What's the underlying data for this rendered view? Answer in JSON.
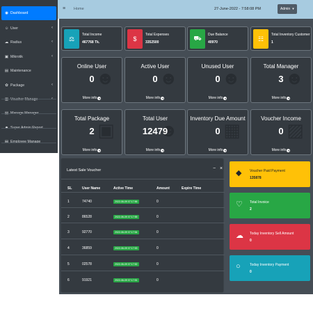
{
  "sidebar": {
    "items": [
      {
        "label": "Dashboard",
        "icon": "dashboard-icon",
        "glyph": "◉",
        "has_submenu": false,
        "active": true
      },
      {
        "label": "User",
        "icon": "user-icon",
        "glyph": "☺",
        "has_submenu": true
      },
      {
        "label": "Radius",
        "icon": "radius-icon",
        "glyph": "☁",
        "has_submenu": true
      },
      {
        "label": "Mikrotik",
        "icon": "mikrotik-icon",
        "glyph": "▣",
        "has_submenu": true
      },
      {
        "label": "Maintenance",
        "icon": "maintenance-icon",
        "glyph": "▤",
        "has_submenu": false
      },
      {
        "label": "Package",
        "icon": "package-icon",
        "glyph": "✿",
        "has_submenu": true
      },
      {
        "label": "Voucher Manage",
        "icon": "voucher-icon",
        "glyph": "▥",
        "has_submenu": true
      },
      {
        "label": "Manage Manager",
        "icon": "manager-icon",
        "glyph": "▤",
        "has_submenu": false
      },
      {
        "label": "Super Admin Report",
        "icon": "report-icon",
        "glyph": "☻",
        "has_submenu": false
      },
      {
        "label": "Employee Manage",
        "icon": "employee-icon",
        "glyph": "▤",
        "has_submenu": false
      }
    ],
    "chevron": "‹"
  },
  "topbar": {
    "menu_glyph": "≡",
    "breadcrumb": "Home",
    "datetime": "27-June-2022 - 7:58:08 PM",
    "admin_label": "Admin",
    "admin_caret": "▾"
  },
  "stats": [
    {
      "title": "Total Income",
      "value": "467768 Tk.",
      "color": "#17a2b8",
      "icon": "scale-icon",
      "glyph": "⚖"
    },
    {
      "title": "Total Expenses",
      "value": "3352500",
      "color": "#dc3545",
      "icon": "money-icon",
      "glyph": "$"
    },
    {
      "title": "Due Balance",
      "value": "40970",
      "color": "#28a745",
      "icon": "cart-icon",
      "glyph": "⛟"
    },
    {
      "title": "Total Inventory Customer",
      "value": "1",
      "color": "#ffc107",
      "icon": "users-icon",
      "glyph": "☷"
    }
  ],
  "summary_row1": [
    {
      "title": "Online User",
      "value": "0",
      "more": "More info",
      "icon": "user-add-icon",
      "glyph": "☻"
    },
    {
      "title": "Active User",
      "value": "0",
      "more": "More info",
      "icon": "user-check-icon",
      "glyph": "☻"
    },
    {
      "title": "Unused User",
      "value": "0",
      "more": "More info",
      "icon": "user-slash-icon",
      "glyph": "☻"
    },
    {
      "title": "Total Manager",
      "value": "3",
      "more": "More info",
      "icon": "manager-tie-icon",
      "glyph": "☻"
    }
  ],
  "summary_row2": [
    {
      "title": "Total Package",
      "value": "2",
      "more": "More info",
      "icon": "box-icon",
      "glyph": "▣"
    },
    {
      "title": "Total User",
      "value": "12479",
      "more": "More info",
      "icon": "user-group-icon",
      "glyph": "☻"
    },
    {
      "title": "Inventory Due Amount",
      "value": "0",
      "more": "More info",
      "icon": "safe-icon",
      "glyph": "▦"
    },
    {
      "title": "Voucher Income",
      "value": "0",
      "more": "More info",
      "icon": "voucher-box-icon",
      "glyph": "▨"
    }
  ],
  "more_arrow": "➜",
  "voucher_table": {
    "title": "Latest Sale Voucher",
    "minimize": "−",
    "close": "×",
    "headers": [
      "SL",
      "User Name",
      "Active Time",
      "Amount",
      "Expire Time"
    ],
    "rows": [
      {
        "sl": "1",
        "user": "74740",
        "time": "2022-06-09 07:17:56",
        "amount": "0",
        "expire": ""
      },
      {
        "sl": "2",
        "user": "86528",
        "time": "2022-06-09 07:17:55",
        "amount": "0",
        "expire": ""
      },
      {
        "sl": "3",
        "user": "92770",
        "time": "2022-06-09 07:17:54",
        "amount": "0",
        "expire": ""
      },
      {
        "sl": "4",
        "user": "36859",
        "time": "2022-06-09 07:17:53",
        "amount": "0",
        "expire": ""
      },
      {
        "sl": "5",
        "user": "02578",
        "time": "2022-06-09 07:17:52",
        "amount": "0",
        "expire": ""
      },
      {
        "sl": "6",
        "user": "91921",
        "time": "2022-06-09 07:17:51",
        "amount": "0",
        "expire": ""
      }
    ]
  },
  "right_cards": [
    {
      "title": "Voucher Paid Payment",
      "value": "135878",
      "color": "#ffc107",
      "text_color": "#212529",
      "icon": "tag-icon",
      "glyph": "◆"
    },
    {
      "title": "Total Invoice",
      "value": "2",
      "color": "#28a745",
      "text_color": "#ffffff",
      "icon": "heart-icon",
      "glyph": "♡"
    },
    {
      "title": "Today Inventory Sell Amount",
      "value": "0",
      "color": "#dc3545",
      "text_color": "#ffffff",
      "icon": "cloud-download-icon",
      "glyph": "☁"
    },
    {
      "title": "Today Inventory Payment",
      "value": "0",
      "color": "#17a2b8",
      "text_color": "#ffffff",
      "icon": "comment-icon",
      "glyph": "○"
    }
  ]
}
